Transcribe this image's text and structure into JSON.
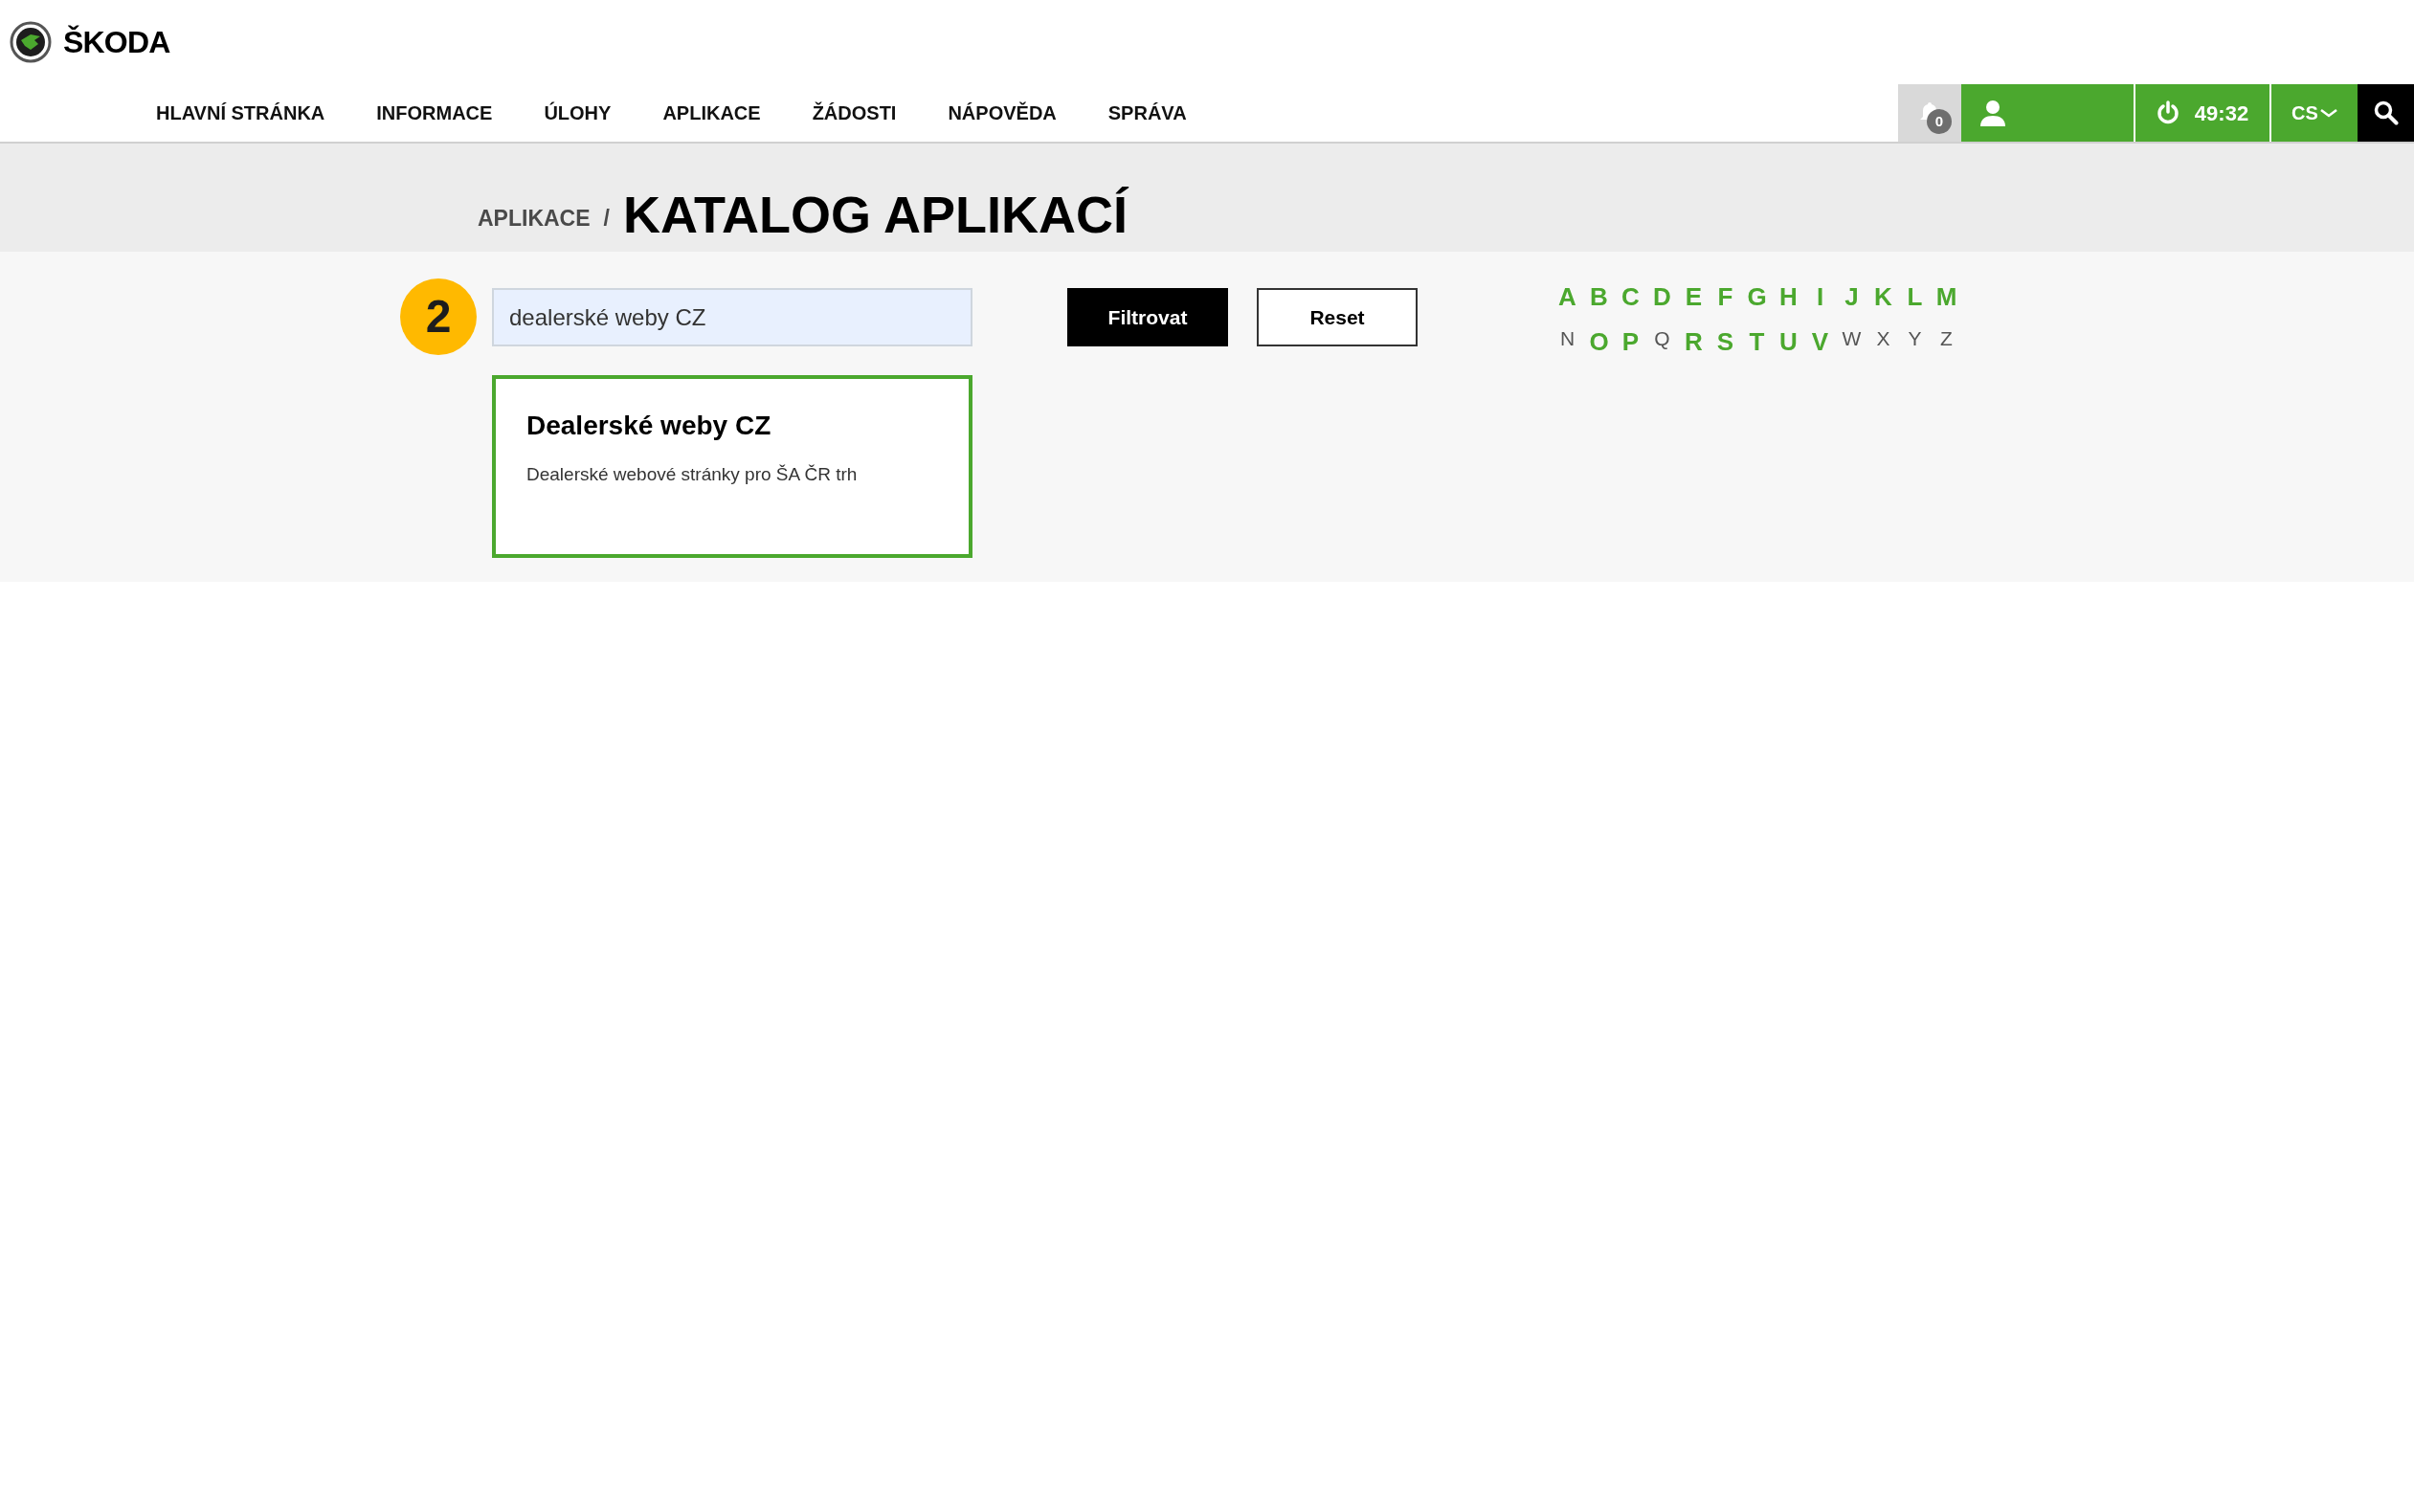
{
  "header": {
    "logo_text": "ŠKODA"
  },
  "nav": [
    {
      "label": "HLAVNÍ STRÁNKA"
    },
    {
      "label": "INFORMACE"
    },
    {
      "label": "ÚLOHY"
    },
    {
      "label": "APLIKACE"
    },
    {
      "label": "ŽÁDOSTI"
    },
    {
      "label": "NÁPOVĚDA"
    },
    {
      "label": "SPRÁVA"
    }
  ],
  "toolbar": {
    "notifications": "0",
    "timer": "49:32",
    "language": "CS"
  },
  "breadcrumb": {
    "parent": "APLIKACE",
    "separator": "/",
    "title": "KATALOG APLIKACÍ"
  },
  "filter": {
    "step": "2",
    "search_value": "dealerské weby CZ",
    "buttons": [
      "Filtrovat",
      "Reset"
    ]
  },
  "letters": [
    {
      "label": "A",
      "disabled": false
    },
    {
      "label": "B",
      "disabled": false
    },
    {
      "label": "C",
      "disabled": false
    },
    {
      "label": "D",
      "disabled": false
    },
    {
      "label": "E",
      "disabled": false
    },
    {
      "label": "F",
      "disabled": false
    },
    {
      "label": "G",
      "disabled": false
    },
    {
      "label": "H",
      "disabled": false
    },
    {
      "label": "I",
      "disabled": false
    },
    {
      "label": "J",
      "disabled": false
    },
    {
      "label": "K",
      "disabled": false
    },
    {
      "label": "L",
      "disabled": false
    },
    {
      "label": "M",
      "disabled": false
    },
    {
      "label": "N",
      "disabled": true
    },
    {
      "label": "O",
      "disabled": false
    },
    {
      "label": "P",
      "disabled": false
    },
    {
      "label": "Q",
      "disabled": true
    },
    {
      "label": "R",
      "disabled": false
    },
    {
      "label": "S",
      "disabled": false
    },
    {
      "label": "T",
      "disabled": false
    },
    {
      "label": "U",
      "disabled": false
    },
    {
      "label": "V",
      "disabled": false
    },
    {
      "label": "W",
      "disabled": true
    },
    {
      "label": "X",
      "disabled": true
    },
    {
      "label": "Y",
      "disabled": true
    },
    {
      "label": "Z",
      "disabled": true
    }
  ],
  "results": [
    {
      "title": "Dealerské weby CZ",
      "description": "Dealerské webové stránky pro ŠA ČR trh"
    }
  ]
}
